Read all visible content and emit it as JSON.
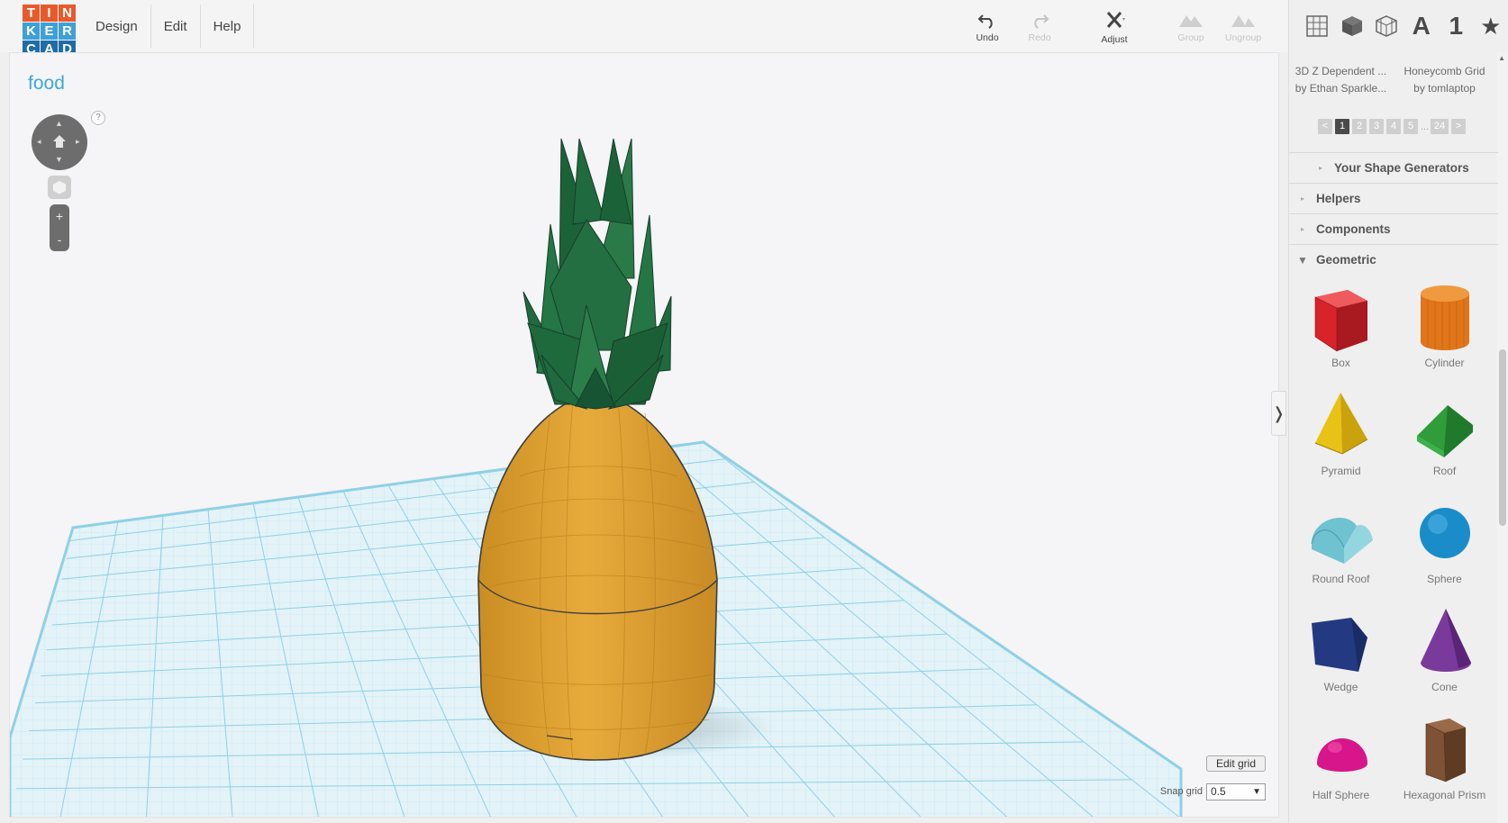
{
  "logo": {
    "letters": [
      "T",
      "I",
      "N",
      "K",
      "E",
      "R",
      "C",
      "A",
      "D"
    ],
    "colors": [
      "#e85a2c",
      "#e85a2c",
      "#e85a2c",
      "#3fa0d8",
      "#3fa0d8",
      "#3fa0d8",
      "#1e6ca8",
      "#1e6ca8",
      "#1e6ca8"
    ]
  },
  "menu": {
    "design": "Design",
    "edit": "Edit",
    "help": "Help"
  },
  "toolbar": {
    "undo": "Undo",
    "redo": "Redo",
    "adjust": "Adjust",
    "group": "Group",
    "ungroup": "Ungroup"
  },
  "viewport": {
    "project_title": "food",
    "help": "?",
    "zoom_in": "+",
    "zoom_out": "-",
    "edit_grid": "Edit grid",
    "snap_label": "Snap grid",
    "snap_value": "0.5",
    "grid_color": "#8fd0e6",
    "collapse": "❭"
  },
  "panel": {
    "tabs": {
      "letter": "A",
      "number": "1",
      "star": "★"
    },
    "generators": [
      {
        "title": "3D Z Dependent ...",
        "author": "by Ethan Sparkle..."
      },
      {
        "title": "Honeycomb Grid",
        "author": "by tomlaptop"
      }
    ],
    "pager": {
      "prev": "<",
      "pages": [
        "1",
        "2",
        "3",
        "4",
        "5"
      ],
      "dots": "...",
      "last": "24",
      "next": ">",
      "active": "1"
    },
    "sections": {
      "your_generators": "Your Shape Generators",
      "helpers": "Helpers",
      "components": "Components",
      "geometric": "Geometric"
    },
    "shapes": [
      {
        "label": "Box",
        "icon": "box-icon",
        "color": "#d8232a"
      },
      {
        "label": "Cylinder",
        "icon": "cylinder-icon",
        "color": "#e0751a"
      },
      {
        "label": "Pyramid",
        "icon": "pyramid-icon",
        "color": "#e8c215"
      },
      {
        "label": "Roof",
        "icon": "roof-icon",
        "color": "#2e9d3a"
      },
      {
        "label": "Round Roof",
        "icon": "round-roof-icon",
        "color": "#6fc2d0"
      },
      {
        "label": "Sphere",
        "icon": "sphere-icon",
        "color": "#1a8cc9"
      },
      {
        "label": "Wedge",
        "icon": "wedge-icon",
        "color": "#233a82"
      },
      {
        "label": "Cone",
        "icon": "cone-icon",
        "color": "#7a3a9c"
      },
      {
        "label": "Half Sphere",
        "icon": "half-sphere-icon",
        "color": "#d6168a"
      },
      {
        "label": "Hexagonal Prism",
        "icon": "hexagonal-prism-icon",
        "color": "#7e5234"
      }
    ]
  },
  "model": {
    "body_color": "#e5a93a",
    "leaf_color": "#1d6b3e"
  }
}
